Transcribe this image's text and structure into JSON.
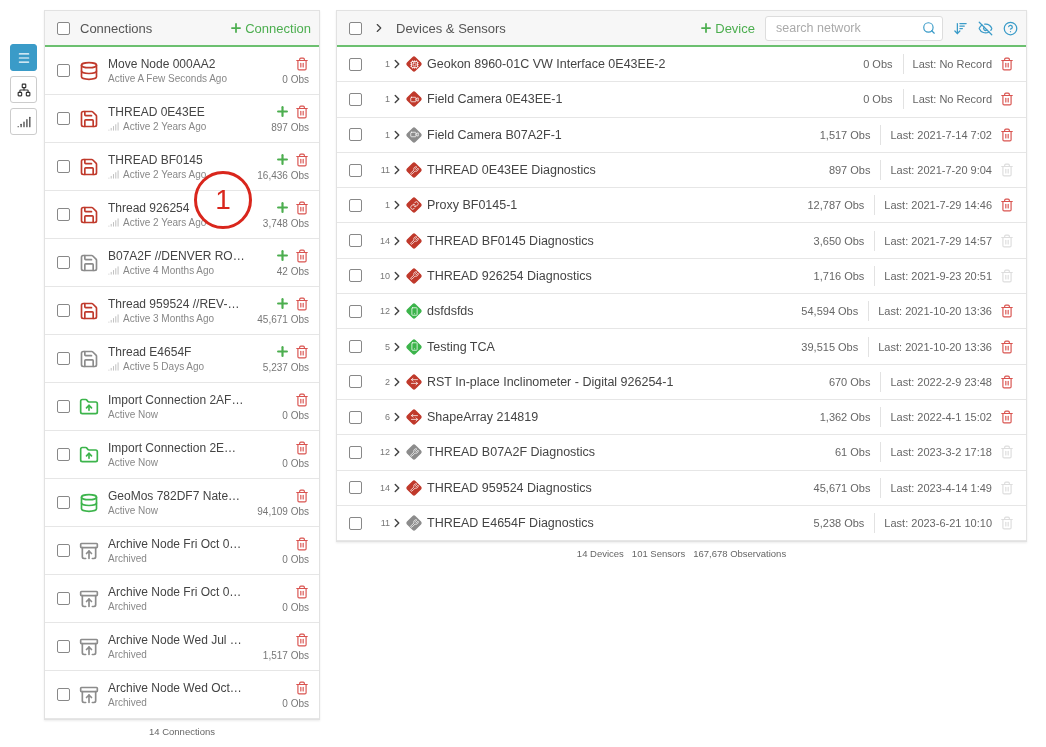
{
  "sidebar": {
    "items": [
      {
        "selected": true
      },
      {
        "selected": false
      },
      {
        "selected": false
      }
    ]
  },
  "connections": {
    "title": "Connections",
    "add_label": "Connection",
    "checked": false,
    "callout": "1",
    "items": [
      {
        "name": "Move Node 000AA2",
        "status": "Active A Few Seconds Ago",
        "obs": "0 Obs",
        "kind": "database",
        "color": "#c0392b",
        "signal": false,
        "can_add": false,
        "checked": false
      },
      {
        "name": "THREAD 0E43EE",
        "status": "Active 2 Years Ago",
        "obs": "897 Obs",
        "kind": "thread",
        "color": "#c0392b",
        "signal": true,
        "can_add": true,
        "checked": false
      },
      {
        "name": "THREAD BF0145",
        "status": "Active 2 Years Ago",
        "obs": "16,436 Obs",
        "kind": "thread",
        "color": "#c0392b",
        "signal": true,
        "can_add": true,
        "checked": false
      },
      {
        "name": "Thread 926254",
        "status": "Active 2 Years Ago",
        "obs": "3,748 Obs",
        "kind": "thread",
        "color": "#c0392b",
        "signal": true,
        "can_add": true,
        "checked": false
      },
      {
        "name": "B07A2F //DENVER RO…",
        "status": "Active 4 Months Ago",
        "obs": "42 Obs",
        "kind": "thread",
        "color": "#8c8c8c",
        "signal": true,
        "can_add": true,
        "checked": false
      },
      {
        "name": "Thread 959524 //REV-…",
        "status": "Active 3 Months Ago",
        "obs": "45,671 Obs",
        "kind": "thread",
        "color": "#c0392b",
        "signal": true,
        "can_add": true,
        "checked": false
      },
      {
        "name": "Thread E4654F",
        "status": "Active 5 Days Ago",
        "obs": "5,237 Obs",
        "kind": "thread",
        "color": "#8c8c8c",
        "signal": true,
        "can_add": true,
        "checked": false
      },
      {
        "name": "Import Connection 2AF…",
        "status": "Active Now",
        "obs": "0 Obs",
        "kind": "import",
        "color": "#3cb44b",
        "signal": false,
        "can_add": false,
        "checked": false
      },
      {
        "name": "Import Connection 2E…",
        "status": "Active Now",
        "obs": "0 Obs",
        "kind": "import",
        "color": "#3cb44b",
        "signal": false,
        "can_add": false,
        "checked": false
      },
      {
        "name": "GeoMos 782DF7 Nate…",
        "status": "Active Now",
        "obs": "94,109 Obs",
        "kind": "database",
        "color": "#3cb44b",
        "signal": false,
        "can_add": false,
        "checked": false
      },
      {
        "name": "Archive Node Fri Oct 0…",
        "status": "Archived",
        "obs": "0 Obs",
        "kind": "archive",
        "color": "#8c8c8c",
        "signal": false,
        "can_add": false,
        "checked": false
      },
      {
        "name": "Archive Node Fri Oct 0…",
        "status": "Archived",
        "obs": "0 Obs",
        "kind": "archive",
        "color": "#8c8c8c",
        "signal": false,
        "can_add": false,
        "checked": false
      },
      {
        "name": "Archive Node Wed Jul …",
        "status": "Archived",
        "obs": "1,517 Obs",
        "kind": "archive",
        "color": "#8c8c8c",
        "signal": false,
        "can_add": false,
        "checked": false
      },
      {
        "name": "Archive Node Wed Oct…",
        "status": "Archived",
        "obs": "0 Obs",
        "kind": "archive",
        "color": "#8c8c8c",
        "signal": false,
        "can_add": false,
        "checked": false
      }
    ],
    "footer": "14 Connections"
  },
  "devices": {
    "title": "Devices & Sensors",
    "add_label": "Device",
    "checked": false,
    "search": {
      "placeholder": "search network"
    },
    "items": [
      {
        "count": "1",
        "name": "Geokon 8960-01C VW Interface 0E43EE-2",
        "obs": "0 Obs",
        "last": "Last: No Record",
        "kind": "interface",
        "color": "#c0392b",
        "deletable": true,
        "checked": false
      },
      {
        "count": "1",
        "name": "Field Camera 0E43EE-1",
        "obs": "0 Obs",
        "last": "Last: No Record",
        "kind": "camera",
        "color": "#c0392b",
        "deletable": true,
        "checked": false
      },
      {
        "count": "1",
        "name": "Field Camera B07A2F-1",
        "obs": "1,517 Obs",
        "last": "Last: 2021-7-14 7:02",
        "kind": "camera",
        "color": "#8c8c8c",
        "deletable": true,
        "checked": false
      },
      {
        "count": "11",
        "name": "THREAD 0E43EE Diagnostics",
        "obs": "897 Obs",
        "last": "Last: 2021-7-20 9:04",
        "kind": "diagnostics",
        "color": "#c0392b",
        "deletable": false,
        "checked": false
      },
      {
        "count": "1",
        "name": "Proxy BF0145-1",
        "obs": "12,787 Obs",
        "last": "Last: 2021-7-29 14:46",
        "kind": "proxy",
        "color": "#c0392b",
        "deletable": true,
        "checked": false
      },
      {
        "count": "14",
        "name": "THREAD BF0145 Diagnostics",
        "obs": "3,650 Obs",
        "last": "Last: 2021-7-29 14:57",
        "kind": "diagnostics",
        "color": "#c0392b",
        "deletable": false,
        "checked": false
      },
      {
        "count": "10",
        "name": "THREAD 926254 Diagnostics",
        "obs": "1,716 Obs",
        "last": "Last: 2021-9-23 20:51",
        "kind": "diagnostics",
        "color": "#c0392b",
        "deletable": false,
        "checked": false
      },
      {
        "count": "12",
        "name": "dsfdsfds",
        "obs": "54,594 Obs",
        "last": "Last: 2021-10-20 13:36",
        "kind": "sensor",
        "color": "#3cb44b",
        "deletable": true,
        "checked": false
      },
      {
        "count": "5",
        "name": "Testing TCA",
        "obs": "39,515 Obs",
        "last": "Last: 2021-10-20 13:36",
        "kind": "sensor",
        "color": "#3cb44b",
        "deletable": true,
        "checked": false
      },
      {
        "count": "2",
        "name": "RST In-place Inclinometer - Digital 926254-1",
        "obs": "670 Obs",
        "last": "Last: 2022-2-9 23:48",
        "kind": "inclinometer",
        "color": "#c0392b",
        "deletable": true,
        "checked": false
      },
      {
        "count": "6",
        "name": "ShapeArray 214819",
        "obs": "1,362 Obs",
        "last": "Last: 2022-4-1 15:02",
        "kind": "inclinometer",
        "color": "#c0392b",
        "deletable": true,
        "checked": false
      },
      {
        "count": "12",
        "name": "THREAD B07A2F Diagnostics",
        "obs": "61 Obs",
        "last": "Last: 2023-3-2 17:18",
        "kind": "diagnostics",
        "color": "#8c8c8c",
        "deletable": false,
        "checked": false
      },
      {
        "count": "14",
        "name": "THREAD 959524 Diagnostics",
        "obs": "45,671 Obs",
        "last": "Last: 2023-4-14 1:49",
        "kind": "diagnostics",
        "color": "#c0392b",
        "deletable": false,
        "checked": false
      },
      {
        "count": "11",
        "name": "THREAD E4654F Diagnostics",
        "obs": "5,238 Obs",
        "last": "Last: 2023-6-21 10:10",
        "kind": "diagnostics",
        "color": "#8c8c8c",
        "deletable": false,
        "checked": false
      }
    ],
    "footer": [
      "14 Devices",
      "101 Sensors",
      "167,678 Observations"
    ]
  }
}
